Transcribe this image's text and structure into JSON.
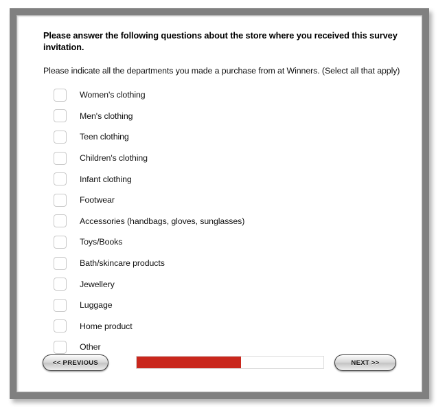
{
  "survey": {
    "heading": "Please answer the following questions about the store where you received this survey invitation.",
    "subheading": "Please indicate all the departments you made a purchase from at Winners. (Select all that apply)",
    "departments": [
      {
        "label": "Women's clothing",
        "checked": false
      },
      {
        "label": "Men's clothing",
        "checked": false
      },
      {
        "label": "Teen clothing",
        "checked": false
      },
      {
        "label": "Children's clothing",
        "checked": false
      },
      {
        "label": "Infant clothing",
        "checked": false
      },
      {
        "label": "Footwear",
        "checked": false
      },
      {
        "label": "Accessories (handbags, gloves, sunglasses)",
        "checked": false
      },
      {
        "label": "Toys/Books",
        "checked": false
      },
      {
        "label": "Bath/skincare products",
        "checked": false
      },
      {
        "label": "Jewellery",
        "checked": false
      },
      {
        "label": "Luggage",
        "checked": false
      },
      {
        "label": "Home product",
        "checked": false
      },
      {
        "label": "Other",
        "checked": false
      }
    ],
    "footer": {
      "previous_label": "<< PREVIOUS",
      "next_label": "NEXT >>",
      "progress_percent": 56
    },
    "colors": {
      "frame_gray": "#808080",
      "progress_red": "#c9271d",
      "progress_track": "#ffffff",
      "checkbox_border": "#c9c9c9"
    }
  }
}
